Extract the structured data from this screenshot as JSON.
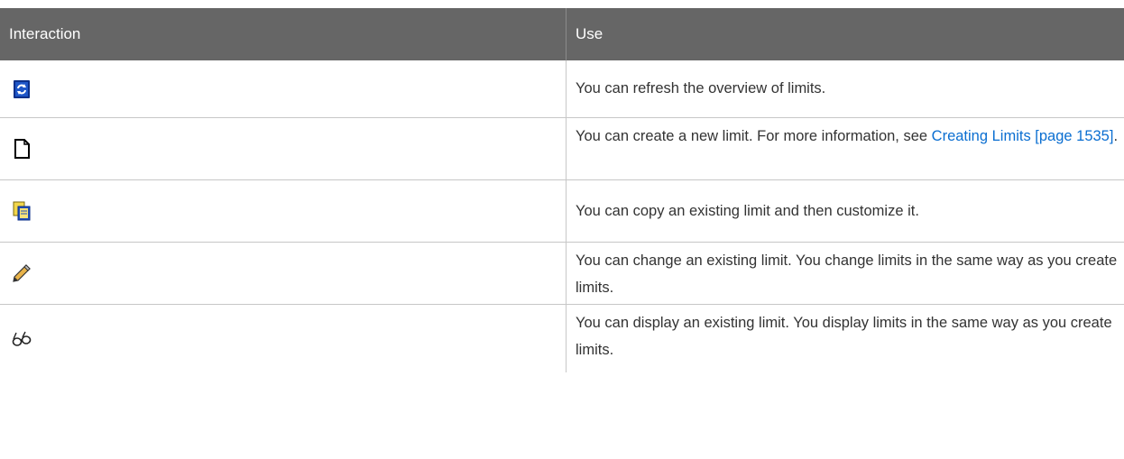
{
  "header": {
    "col1": "Interaction",
    "col2": "Use"
  },
  "rows": [
    {
      "icon": "refresh-icon",
      "text": "You can refresh the overview of limits."
    },
    {
      "icon": "new-document-icon",
      "text": "You can create a new limit. For more information, see ",
      "link": "Creating Limits [page 1535]",
      "after": "."
    },
    {
      "icon": "copy-icon",
      "text": "You can copy an existing limit and then customize it."
    },
    {
      "icon": "pencil-icon",
      "text": "You can change an existing limit. You change limits in the same way as you create limits."
    },
    {
      "icon": "glasses-icon",
      "text": "You can display an existing limit. You display limits in the same way as you create limits."
    }
  ]
}
